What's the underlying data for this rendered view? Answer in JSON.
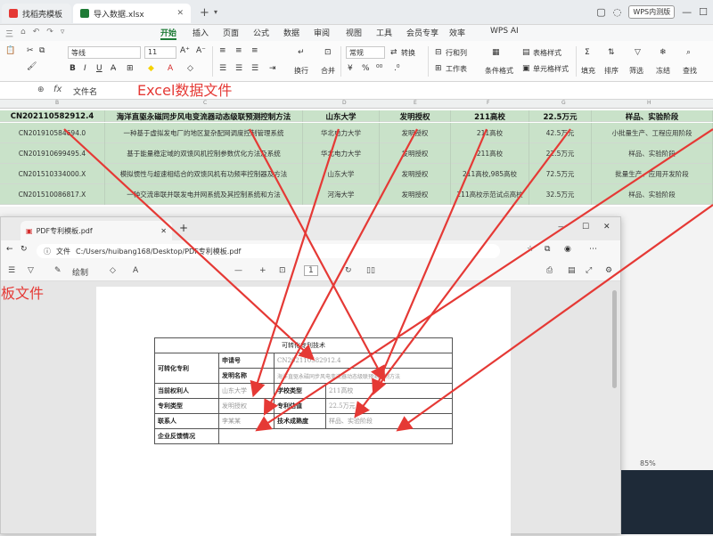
{
  "titlebar": {
    "tabs": [
      {
        "label": "找稻壳模板",
        "color": "#e53935"
      },
      {
        "label": "导入数据.xlsx",
        "color": "#1e7b36"
      }
    ],
    "new_tab": "+",
    "badge": "WPS内测版"
  },
  "menubar": {
    "quick_items": [
      "三",
      "⌂",
      "↶",
      "↷",
      "▿"
    ],
    "items": [
      "开始",
      "插入",
      "页面",
      "公式",
      "数据",
      "审阅",
      "视图",
      "工具",
      "会员专享",
      "效率",
      "WPS AI"
    ],
    "active": "开始"
  },
  "toolbar": {
    "font_name": "等线",
    "font_size": "11",
    "number_format": "常规",
    "convert_label": "转换",
    "row_col_label": "行和列",
    "worksheet_label": "工作表",
    "conditional_label": "条件格式",
    "table_style_label": "表格样式",
    "cell_style_label": "单元格样式",
    "labels": [
      "换行",
      "合并",
      "填充",
      "排序",
      "冻结",
      "查找"
    ],
    "extra_labels": [
      "求和",
      "筛选"
    ],
    "font_color": "#d42b2b",
    "fill_color": "#f5d200"
  },
  "formulabar": {
    "fx": "fx",
    "value": "文件名",
    "caption": "Excel数据文件"
  },
  "sheet": {
    "col_headers": [
      "B",
      "C",
      "D",
      "E",
      "F",
      "G",
      "H"
    ],
    "rows": [
      [
        "CN202110582912.4",
        "海洋直驱永磁同步风电变流器动态级联预测控制方法",
        "山东大学",
        "发明授权",
        "211高校",
        "22.5万元",
        "样品、实验阶段"
      ],
      [
        "CN201910584694.0",
        "一种基于虚拟发电厂的地区复杂配网调度控制管理系统",
        "华北电力大学",
        "发明授权",
        "211高校",
        "42.5万元",
        "小批量生产、工程应用阶段"
      ],
      [
        "CN201910699495.4",
        "基于能量稳定域的双馈风机控制参数优化方法及系统",
        "华北电力大学",
        "发明授权",
        "211高校",
        "22.5万元",
        "样品、实验阶段"
      ],
      [
        "CN201510334000.X",
        "模拟惯性与超速相结合的双馈风机有功频率控制器及方法",
        "山东大学",
        "发明授权",
        "211高校,985高校",
        "72.5万元",
        "批量生产、应用开发阶段"
      ],
      [
        "CN201510086817.X",
        "一种交流串联并联发电并网系统及其控制系统和方法",
        "河海大学",
        "发明授权",
        "211高校示范试点高校",
        "32.5万元",
        "样品、实验阶段"
      ]
    ]
  },
  "pdf": {
    "tab_title": "PDF专利模板.pdf",
    "address_label": "文件",
    "address": "C:/Users/huibang168/Desktop/PDF专利模板.pdf",
    "draw_label": "绘制",
    "page_number": "1",
    "caption": "板文件",
    "form": {
      "title": "可转化专利技术",
      "label_patent": "可转化专利",
      "label_app_no": "申请号",
      "val_app_no": "CN202110582912.4",
      "label_name": "发明名称",
      "val_name": "海洋直驱永磁同步风电变流器动态级联预测控制方法",
      "label_owner": "当前权利人",
      "val_owner": "山东大学",
      "label_school": "学校类型",
      "val_school": "211高校",
      "label_type": "专利类型",
      "val_type": "发明授权",
      "label_price": "专利估值",
      "val_price": "22.5万元",
      "label_contact": "联系人",
      "val_contact": "李某某",
      "label_maturity": "技术成熟度",
      "val_maturity": "样品、实验阶段",
      "label_feedback": "企业反馈情况"
    }
  },
  "status": {
    "zoom": "85%"
  },
  "colors": {
    "arrow": "#e53935",
    "selected_row": "#c9e2c9",
    "accent": "#1e7b36"
  }
}
